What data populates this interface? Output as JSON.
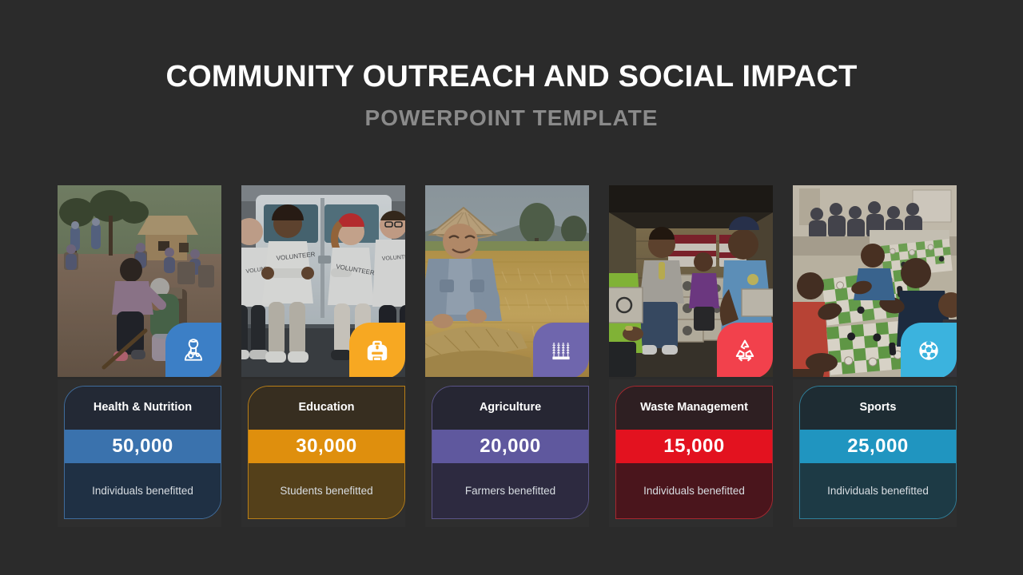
{
  "header": {
    "title": "COMMUNITY OUTREACH AND SOCIAL IMPACT",
    "subtitle": "POWERPOINT TEMPLATE"
  },
  "theme": {
    "background": "#2b2b2b",
    "panel_background": "#2e2e2e",
    "title_color": "#ffffff",
    "subtitle_color": "#8a8a8a",
    "sub_text_color": "#d8dde2"
  },
  "cards": [
    {
      "title": "Health & Nutrition",
      "value": "50,000",
      "subtitle": "Individuals benefitted",
      "icon": "doctor-icon",
      "accent": "#3a72ad",
      "badge_color": "#3c7fc6",
      "title_bg": "#232935",
      "sub_bg": "#1f3044",
      "border": "#3f6c9c",
      "photo": "community-health-outreach-photo"
    },
    {
      "title": "Education",
      "value": "30,000",
      "subtitle": "Students benefitted",
      "icon": "backpack-icon",
      "accent": "#df8f0d",
      "badge_color": "#f7a822",
      "title_bg": "#372e20",
      "sub_bg": "#54401a",
      "border": "#b97f17",
      "photo": "volunteers-van-photo"
    },
    {
      "title": "Agriculture",
      "value": "20,000",
      "subtitle": "Farmers benefitted",
      "icon": "wheat-icon",
      "accent": "#5f589e",
      "badge_color": "#6f66ad",
      "title_bg": "#262633",
      "sub_bg": "#2d2a40",
      "border": "#5a5488",
      "photo": "rice-harvest-farmer-photo"
    },
    {
      "title": "Waste Management",
      "value": "15,000",
      "subtitle": "Individuals benefitted",
      "icon": "recycle-icon",
      "accent": "#e3121f",
      "badge_color": "#f2414c",
      "title_bg": "#2e1f22",
      "sub_bg": "#4a151c",
      "border": "#a8272f",
      "photo": "relief-supplies-truck-photo"
    },
    {
      "title": "Sports",
      "value": "25,000",
      "subtitle": "Individuals benefitted",
      "icon": "soccer-ball-icon",
      "accent": "#2095c0",
      "badge_color": "#3bb3de",
      "title_bg": "#1e2c33",
      "sub_bg": "#1d3a45",
      "border": "#2f7f9b",
      "photo": "chess-tournament-photo"
    }
  ]
}
